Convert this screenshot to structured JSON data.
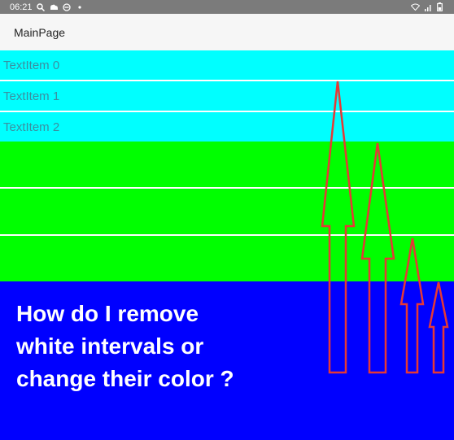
{
  "status_bar": {
    "time": "06:21",
    "left_icons": [
      "search-icon",
      "cloud-sync-icon",
      "do-not-disturb-icon",
      "dot-icon"
    ],
    "right_icons": [
      "wifi-icon",
      "signal-icon",
      "battery-icon"
    ]
  },
  "app_bar": {
    "title": "MainPage"
  },
  "list": {
    "items": [
      {
        "label": "TextItem 0",
        "color": "#00ffff"
      },
      {
        "label": "TextItem 1",
        "color": "#00ffff"
      },
      {
        "label": "TextItem 2",
        "color": "#00ffff"
      },
      {
        "label": "",
        "color": "#00ff00"
      },
      {
        "label": "",
        "color": "#00ff00"
      },
      {
        "label": "",
        "color": "#00ff00"
      }
    ],
    "separator_color": "#ffffff",
    "page_background": "#0000ff"
  },
  "annotation": {
    "lines": [
      "How do I remove",
      "white intervals or",
      "change their color ?"
    ],
    "arrow_color": "#e53935",
    "arrow_count": 4
  }
}
